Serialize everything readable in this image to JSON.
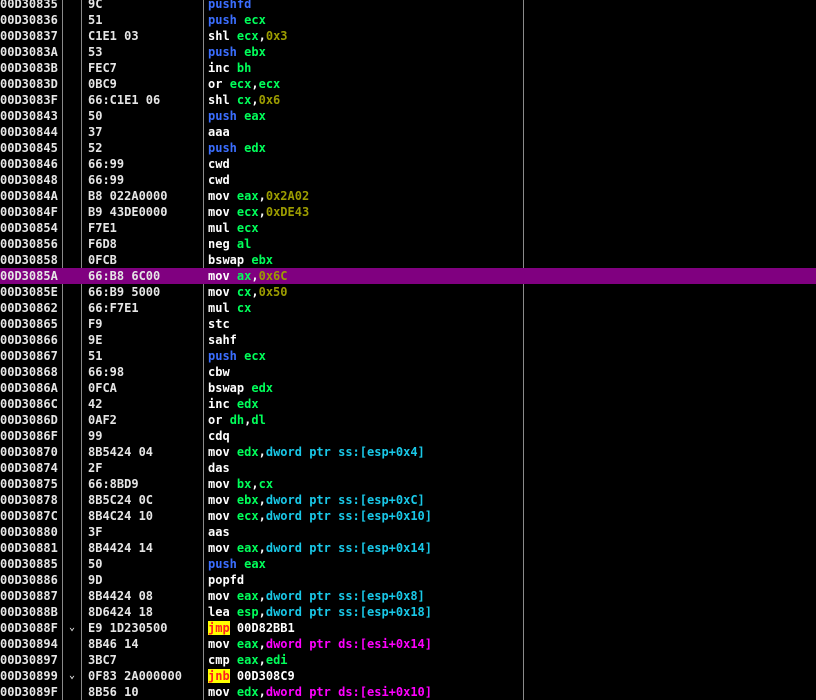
{
  "colors": {
    "background": "#000000",
    "selected_row": "#800080",
    "plain": "#ffffff",
    "push_pop": "#3b6eff",
    "register": "#00ff5a",
    "constant": "#9c9c00",
    "memory_ds": "#ff00ff",
    "memory_ss": "#19c8e8",
    "jump_fg": "#ff2020",
    "jump_bg": "#ffff00"
  },
  "rows": [
    {
      "addr": "00D30835",
      "mark": "",
      "bytes": "9C",
      "instr": [
        {
          "t": "pushfd",
          "c": "push"
        }
      ]
    },
    {
      "addr": "00D30836",
      "mark": "",
      "bytes": "51",
      "instr": [
        {
          "t": "push",
          "c": "push"
        },
        {
          "t": " "
        },
        {
          "t": "ecx",
          "c": "reg"
        }
      ]
    },
    {
      "addr": "00D30837",
      "mark": "",
      "bytes": "C1E1 03",
      "instr": [
        {
          "t": "shl"
        },
        {
          "t": " "
        },
        {
          "t": "ecx",
          "c": "reg"
        },
        {
          "t": ","
        },
        {
          "t": "0x3",
          "c": "num"
        }
      ]
    },
    {
      "addr": "00D3083A",
      "mark": "",
      "bytes": "53",
      "instr": [
        {
          "t": "push",
          "c": "push"
        },
        {
          "t": " "
        },
        {
          "t": "ebx",
          "c": "reg"
        }
      ]
    },
    {
      "addr": "00D3083B",
      "mark": "",
      "bytes": "FEC7",
      "instr": [
        {
          "t": "inc"
        },
        {
          "t": " "
        },
        {
          "t": "bh",
          "c": "reg"
        }
      ]
    },
    {
      "addr": "00D3083D",
      "mark": "",
      "bytes": "0BC9",
      "instr": [
        {
          "t": "or"
        },
        {
          "t": " "
        },
        {
          "t": "ecx",
          "c": "reg"
        },
        {
          "t": ","
        },
        {
          "t": "ecx",
          "c": "reg"
        }
      ]
    },
    {
      "addr": "00D3083F",
      "mark": "",
      "bytes": "66:C1E1 06",
      "instr": [
        {
          "t": "shl"
        },
        {
          "t": " "
        },
        {
          "t": "cx",
          "c": "reg"
        },
        {
          "t": ","
        },
        {
          "t": "0x6",
          "c": "num"
        }
      ]
    },
    {
      "addr": "00D30843",
      "mark": "",
      "bytes": "50",
      "instr": [
        {
          "t": "push",
          "c": "push"
        },
        {
          "t": " "
        },
        {
          "t": "eax",
          "c": "reg"
        }
      ]
    },
    {
      "addr": "00D30844",
      "mark": "",
      "bytes": "37",
      "instr": [
        {
          "t": "aaa"
        }
      ]
    },
    {
      "addr": "00D30845",
      "mark": "",
      "bytes": "52",
      "instr": [
        {
          "t": "push",
          "c": "push"
        },
        {
          "t": " "
        },
        {
          "t": "edx",
          "c": "reg"
        }
      ]
    },
    {
      "addr": "00D30846",
      "mark": "",
      "bytes": "66:99",
      "instr": [
        {
          "t": "cwd"
        }
      ]
    },
    {
      "addr": "00D30848",
      "mark": "",
      "bytes": "66:99",
      "instr": [
        {
          "t": "cwd"
        }
      ]
    },
    {
      "addr": "00D3084A",
      "mark": "",
      "bytes": "B8 022A0000",
      "instr": [
        {
          "t": "mov"
        },
        {
          "t": " "
        },
        {
          "t": "eax",
          "c": "reg"
        },
        {
          "t": ","
        },
        {
          "t": "0x2A02",
          "c": "num"
        }
      ]
    },
    {
      "addr": "00D3084F",
      "mark": "",
      "bytes": "B9 43DE0000",
      "instr": [
        {
          "t": "mov"
        },
        {
          "t": " "
        },
        {
          "t": "ecx",
          "c": "reg"
        },
        {
          "t": ","
        },
        {
          "t": "0xDE43",
          "c": "num"
        }
      ]
    },
    {
      "addr": "00D30854",
      "mark": "",
      "bytes": "F7E1",
      "instr": [
        {
          "t": "mul"
        },
        {
          "t": " "
        },
        {
          "t": "ecx",
          "c": "reg"
        }
      ]
    },
    {
      "addr": "00D30856",
      "mark": "",
      "bytes": "F6D8",
      "instr": [
        {
          "t": "neg"
        },
        {
          "t": " "
        },
        {
          "t": "al",
          "c": "reg"
        }
      ]
    },
    {
      "addr": "00D30858",
      "mark": "",
      "bytes": "0FCB",
      "instr": [
        {
          "t": "bswap"
        },
        {
          "t": " "
        },
        {
          "t": "ebx",
          "c": "reg"
        }
      ]
    },
    {
      "addr": "00D3085A",
      "mark": "",
      "bytes": "66:B8 6C00",
      "selected": true,
      "instr": [
        {
          "t": "mov"
        },
        {
          "t": " "
        },
        {
          "t": "ax",
          "c": "reg"
        },
        {
          "t": ","
        },
        {
          "t": "0x6C",
          "c": "num"
        }
      ]
    },
    {
      "addr": "00D3085E",
      "mark": "",
      "bytes": "66:B9 5000",
      "instr": [
        {
          "t": "mov"
        },
        {
          "t": " "
        },
        {
          "t": "cx",
          "c": "reg"
        },
        {
          "t": ","
        },
        {
          "t": "0x50",
          "c": "num"
        }
      ]
    },
    {
      "addr": "00D30862",
      "mark": "",
      "bytes": "66:F7E1",
      "instr": [
        {
          "t": "mul"
        },
        {
          "t": " "
        },
        {
          "t": "cx",
          "c": "reg"
        }
      ]
    },
    {
      "addr": "00D30865",
      "mark": "",
      "bytes": "F9",
      "instr": [
        {
          "t": "stc"
        }
      ]
    },
    {
      "addr": "00D30866",
      "mark": "",
      "bytes": "9E",
      "instr": [
        {
          "t": "sahf"
        }
      ]
    },
    {
      "addr": "00D30867",
      "mark": "",
      "bytes": "51",
      "instr": [
        {
          "t": "push",
          "c": "push"
        },
        {
          "t": " "
        },
        {
          "t": "ecx",
          "c": "reg"
        }
      ]
    },
    {
      "addr": "00D30868",
      "mark": "",
      "bytes": "66:98",
      "instr": [
        {
          "t": "cbw"
        }
      ]
    },
    {
      "addr": "00D3086A",
      "mark": "",
      "bytes": "0FCA",
      "instr": [
        {
          "t": "bswap"
        },
        {
          "t": " "
        },
        {
          "t": "edx",
          "c": "reg"
        }
      ]
    },
    {
      "addr": "00D3086C",
      "mark": "",
      "bytes": "42",
      "instr": [
        {
          "t": "inc"
        },
        {
          "t": " "
        },
        {
          "t": "edx",
          "c": "reg"
        }
      ]
    },
    {
      "addr": "00D3086D",
      "mark": "",
      "bytes": "0AF2",
      "instr": [
        {
          "t": "or"
        },
        {
          "t": " "
        },
        {
          "t": "dh",
          "c": "reg"
        },
        {
          "t": ","
        },
        {
          "t": "dl",
          "c": "reg"
        }
      ]
    },
    {
      "addr": "00D3086F",
      "mark": "",
      "bytes": "99",
      "instr": [
        {
          "t": "cdq"
        }
      ]
    },
    {
      "addr": "00D30870",
      "mark": "",
      "bytes": "8B5424 04",
      "instr": [
        {
          "t": "mov"
        },
        {
          "t": " "
        },
        {
          "t": "edx",
          "c": "reg"
        },
        {
          "t": ","
        },
        {
          "t": "dword ptr ss:[esp+0x4]",
          "c": "stack"
        }
      ]
    },
    {
      "addr": "00D30874",
      "mark": "",
      "bytes": "2F",
      "instr": [
        {
          "t": "das"
        }
      ]
    },
    {
      "addr": "00D30875",
      "mark": "",
      "bytes": "66:8BD9",
      "instr": [
        {
          "t": "mov"
        },
        {
          "t": " "
        },
        {
          "t": "bx",
          "c": "reg"
        },
        {
          "t": ","
        },
        {
          "t": "cx",
          "c": "reg"
        }
      ]
    },
    {
      "addr": "00D30878",
      "mark": "",
      "bytes": "8B5C24 0C",
      "instr": [
        {
          "t": "mov"
        },
        {
          "t": " "
        },
        {
          "t": "ebx",
          "c": "reg"
        },
        {
          "t": ","
        },
        {
          "t": "dword ptr ss:[esp+0xC]",
          "c": "stack"
        }
      ]
    },
    {
      "addr": "00D3087C",
      "mark": "",
      "bytes": "8B4C24 10",
      "instr": [
        {
          "t": "mov"
        },
        {
          "t": " "
        },
        {
          "t": "ecx",
          "c": "reg"
        },
        {
          "t": ","
        },
        {
          "t": "dword ptr ss:[esp+0x10]",
          "c": "stack"
        }
      ]
    },
    {
      "addr": "00D30880",
      "mark": "",
      "bytes": "3F",
      "instr": [
        {
          "t": "aas"
        }
      ]
    },
    {
      "addr": "00D30881",
      "mark": "",
      "bytes": "8B4424 14",
      "instr": [
        {
          "t": "mov"
        },
        {
          "t": " "
        },
        {
          "t": "eax",
          "c": "reg"
        },
        {
          "t": ","
        },
        {
          "t": "dword ptr ss:[esp+0x14]",
          "c": "stack"
        }
      ]
    },
    {
      "addr": "00D30885",
      "mark": "",
      "bytes": "50",
      "instr": [
        {
          "t": "push",
          "c": "push"
        },
        {
          "t": " "
        },
        {
          "t": "eax",
          "c": "reg"
        }
      ]
    },
    {
      "addr": "00D30886",
      "mark": "",
      "bytes": "9D",
      "instr": [
        {
          "t": "popfd"
        }
      ]
    },
    {
      "addr": "00D30887",
      "mark": "",
      "bytes": "8B4424 08",
      "instr": [
        {
          "t": "mov"
        },
        {
          "t": " "
        },
        {
          "t": "eax",
          "c": "reg"
        },
        {
          "t": ","
        },
        {
          "t": "dword ptr ss:[esp+0x8]",
          "c": "stack"
        }
      ]
    },
    {
      "addr": "00D3088B",
      "mark": "",
      "bytes": "8D6424 18",
      "instr": [
        {
          "t": "lea"
        },
        {
          "t": " "
        },
        {
          "t": "esp",
          "c": "reg"
        },
        {
          "t": ","
        },
        {
          "t": "dword ptr ss:[esp+0x18]",
          "c": "stack"
        }
      ]
    },
    {
      "addr": "00D3088F",
      "mark": "⌄",
      "bytes": "E9 1D230500",
      "instr": [
        {
          "t": "jmp",
          "c": "jump"
        },
        {
          "t": " "
        },
        {
          "t": "00D82BB1"
        }
      ]
    },
    {
      "addr": "00D30894",
      "mark": "",
      "bytes": "8B46 14",
      "instr": [
        {
          "t": "mov"
        },
        {
          "t": " "
        },
        {
          "t": "eax",
          "c": "reg"
        },
        {
          "t": ","
        },
        {
          "t": "dword ptr ds:[esi+0x14]",
          "c": "mem"
        }
      ]
    },
    {
      "addr": "00D30897",
      "mark": "",
      "bytes": "3BC7",
      "instr": [
        {
          "t": "cmp"
        },
        {
          "t": " "
        },
        {
          "t": "eax",
          "c": "reg"
        },
        {
          "t": ","
        },
        {
          "t": "edi",
          "c": "reg"
        }
      ]
    },
    {
      "addr": "00D30899",
      "mark": "⌄",
      "bytes": "0F83 2A000000",
      "instr": [
        {
          "t": "jnb",
          "c": "jump"
        },
        {
          "t": " "
        },
        {
          "t": "00D308C9"
        }
      ]
    },
    {
      "addr": "00D3089F",
      "mark": "",
      "bytes": "8B56 10",
      "instr": [
        {
          "t": "mov"
        },
        {
          "t": " "
        },
        {
          "t": "edx",
          "c": "reg"
        },
        {
          "t": ","
        },
        {
          "t": "dword ptr ds:[esi+0x10]",
          "c": "mem"
        }
      ]
    }
  ]
}
